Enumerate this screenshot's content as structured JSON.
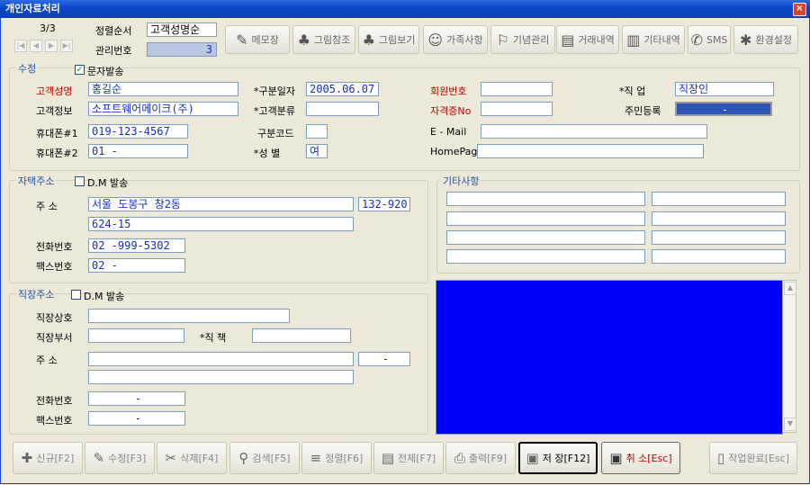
{
  "window": {
    "title": "개인자료처리",
    "close": "×"
  },
  "nav": {
    "counter": "3/3"
  },
  "sort": {
    "label": "정렬순서",
    "value": "고객성명순",
    "mgmt_label": "관리번호",
    "mgmt_value": "3"
  },
  "toolbar": [
    {
      "label": "메모장",
      "icon": "notepad-icon",
      "glyph": "✎"
    },
    {
      "label": "그림참조",
      "icon": "tree-icon",
      "glyph": "♣"
    },
    {
      "label": "그림보기",
      "icon": "tree-icon",
      "glyph": "♣"
    },
    {
      "label": "가족사항",
      "icon": "people-icon",
      "glyph": "☺"
    },
    {
      "label": "기념관리",
      "icon": "monument-icon",
      "glyph": "⚐"
    },
    {
      "label": "거래내역",
      "icon": "document-icon",
      "glyph": "▤"
    },
    {
      "label": "기타내역",
      "icon": "document-icon",
      "glyph": "▥"
    },
    {
      "label": "SMS",
      "icon": "phone-icon",
      "glyph": "✆"
    },
    {
      "label": "환경설정",
      "icon": "tools-icon",
      "glyph": "✱"
    }
  ],
  "edit": {
    "title": "수정",
    "sms_label": "문자발송",
    "name_label": "고객성명",
    "name": "홍길순",
    "info_label": "고객정보",
    "info": "소프트웨어메이크(주)",
    "mobile1_label": "휴대폰#1",
    "mobile1": "019-123-4567",
    "mobile2_label": "휴대폰#2",
    "mobile2": "01 -",
    "date_label": "*구분일자",
    "date": "2005.06.07",
    "category_label": "*고객분류",
    "category": "",
    "code_label": "구분코드",
    "code": "",
    "gender_label": "*성    별",
    "gender": "여",
    "member_label": "회원번호",
    "member": "",
    "license_label": "자격증No",
    "license": "",
    "email_label": "E - Mail",
    "email": "",
    "homepage_label": "HomePage",
    "homepage": "",
    "job_label": "*직    업",
    "job": "직장인",
    "resident_label": "주민등록",
    "resident": "-"
  },
  "home": {
    "title": "자택주소",
    "dm_label": "D.M 발송",
    "addr_label": "주    소",
    "addr1": "서울 도봉구 창2동",
    "zip": "132-920",
    "addr2": "624-15",
    "phone_label": "전화번호",
    "phone": "02  -999-5302",
    "fax_label": "팩스번호",
    "fax": "02  -"
  },
  "other": {
    "title": "기타사항"
  },
  "work": {
    "title": "직장주소",
    "dm_label": "D.M 발송",
    "company_label": "직장상호",
    "company": "",
    "dept_label": "직장부서",
    "dept": "",
    "position_label": "*직    책",
    "position": "",
    "addr_label": "주    소",
    "zip": "-",
    "addr1": "",
    "addr2": "",
    "phone_label": "전화번호",
    "phone": "-",
    "fax_label": "팩스번호",
    "fax": "-"
  },
  "bottom": [
    {
      "label": "신규[F2]",
      "icon": "new-icon",
      "glyph": "✚"
    },
    {
      "label": "수정[F3]",
      "icon": "edit-icon",
      "glyph": "✎"
    },
    {
      "label": "삭제[F4]",
      "icon": "delete-icon",
      "glyph": "✂"
    },
    {
      "label": "검색[F5]",
      "icon": "search-icon",
      "glyph": "⚲"
    },
    {
      "label": "정렬[F6]",
      "icon": "sort-icon",
      "glyph": "≡"
    },
    {
      "label": "전체[F7]",
      "icon": "list-icon",
      "glyph": "▤"
    },
    {
      "label": "출력[F9]",
      "icon": "printer-icon",
      "glyph": "⎙"
    },
    {
      "label": "저 장[F12]",
      "icon": "save-icon",
      "glyph": "▣"
    },
    {
      "label": "취 소[Esc]",
      "icon": "cancel-icon",
      "glyph": "▣"
    },
    {
      "label": "작업완료[Esc]",
      "icon": "door-icon",
      "glyph": "▯"
    }
  ],
  "colors": {
    "memo_bg": "#0000FF",
    "label_red": "#C00000",
    "title_blue": "#0A49C9"
  }
}
